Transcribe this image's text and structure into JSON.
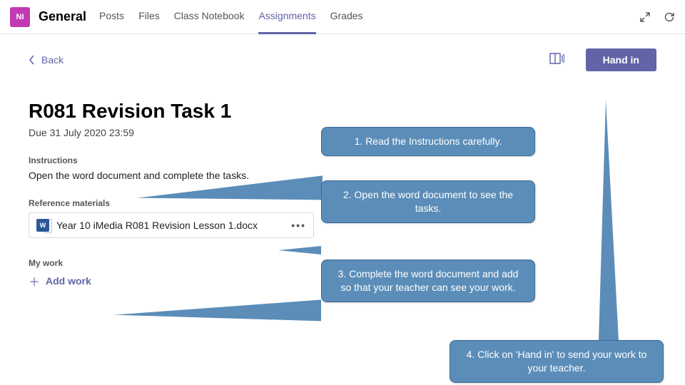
{
  "header": {
    "team_badge": "NI",
    "channel_name": "General",
    "tabs": [
      "Posts",
      "Files",
      "Class Notebook",
      "Assignments",
      "Grades"
    ],
    "active_tab_index": 3
  },
  "actions": {
    "back_label": "Back",
    "hand_in_label": "Hand in"
  },
  "assignment": {
    "title": "R081 Revision Task 1",
    "due": "Due 31 July 2020 23:59",
    "instructions_label": "Instructions",
    "instructions_text": "Open the word document and complete the tasks.",
    "reference_label": "Reference materials",
    "reference_file": "Year 10 iMedia R081 Revision Lesson 1.docx",
    "more_dots": "•••",
    "mywork_label": "My work",
    "add_work_label": "Add work"
  },
  "callouts": {
    "c1": "1. Read the Instructions carefully.",
    "c2": "2. Open the word document to see the tasks.",
    "c3": "3. Complete the word document and add so that your teacher can see your work.",
    "c4": "4. Click on 'Hand in' to send your work to your teacher."
  },
  "colors": {
    "accent": "#6264a7",
    "badge": "#c239b3",
    "callout": "#5b8db8"
  }
}
